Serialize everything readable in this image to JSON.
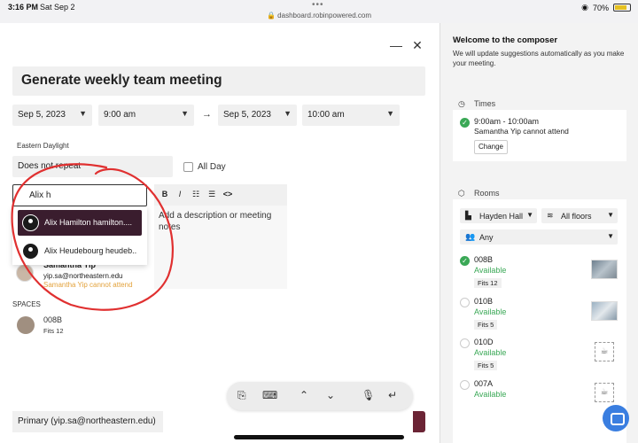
{
  "status_bar": {
    "time": "3:16 PM",
    "date": "Sat Sep 2",
    "url": "dashboard.robinpowered.com",
    "battery": "70%"
  },
  "composer": {
    "title": "Generate weekly team meeting",
    "start_date": "Sep 5, 2023",
    "start_time": "9:00 am",
    "arrow": "→",
    "end_date": "Sep 5, 2023",
    "end_time": "10:00 am",
    "timezone": "Eastern Daylight",
    "repeat": "Does not repeat",
    "all_day_label": "All Day",
    "attendee_search": "Alix h",
    "suggestions": [
      "Alix Hamilton hamilton....",
      "Alix Heudebourg heudeb..."
    ],
    "editor_tools": {
      "bold": "B",
      "italic": "I",
      "ul": "☷",
      "ol": "☰",
      "code": "<>"
    },
    "description_placeholder": "Add a description or meeting notes",
    "attendee": {
      "name": "Samantha Yip",
      "email": "yip.sa@northeastern.edu",
      "warning": "Samantha Yip cannot attend"
    },
    "spaces_label": "SPACES",
    "space": {
      "name": "008B",
      "fits": "Fits 12"
    },
    "calendar": "Primary (yip.sa@northeastern.edu)"
  },
  "sidebar": {
    "welcome_title": "Welcome to the composer",
    "welcome_text": "We will update suggestions automatically as you make your meeting.",
    "times_label": "Times",
    "time_slot": "9:00am - 10:00am",
    "time_warning": "Samantha Yip cannot attend",
    "change_label": "Change",
    "rooms_label": "Rooms",
    "building": "Hayden Hall",
    "floors": "All floors",
    "capacity": "Any",
    "rooms": [
      {
        "name": "008B",
        "status": "Available",
        "fits": "Fits 12"
      },
      {
        "name": "010B",
        "status": "Available",
        "fits": "Fits 5"
      },
      {
        "name": "010D",
        "status": "Available",
        "fits": "Fits 5"
      },
      {
        "name": "007A",
        "status": "Available",
        "fits": ""
      }
    ]
  },
  "colors": {
    "accent": "#6b2435",
    "available": "#3aa856",
    "warning": "#e3a23b",
    "annotation": "#e03030"
  }
}
